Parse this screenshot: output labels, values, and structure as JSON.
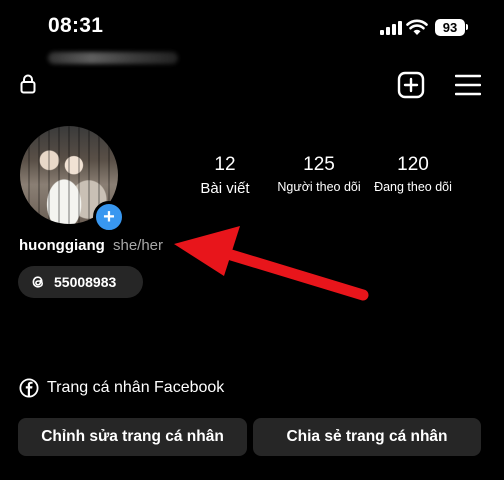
{
  "status_bar": {
    "time": "08:31",
    "battery": "93"
  },
  "profile": {
    "username": "huonggiang",
    "pronouns": "she/her",
    "threads_handle": "55008983"
  },
  "stats": {
    "posts": {
      "value": "12",
      "label": "Bài viết"
    },
    "followers": {
      "value": "125",
      "label": "Người theo dõi"
    },
    "following": {
      "value": "120",
      "label": "Đang theo dõi"
    }
  },
  "links": {
    "facebook": "Trang cá nhân Facebook"
  },
  "buttons": {
    "edit_profile": "Chỉnh sửa trang cá nhân",
    "share_profile": "Chia sẻ trang cá nhân"
  },
  "icons": [
    "lock-icon",
    "add-post-icon",
    "menu-icon",
    "threads-icon",
    "facebook-icon",
    "plus-icon"
  ],
  "colors": {
    "background": "#000000",
    "button": "#262626",
    "accent_blue": "#3897f0",
    "annotation_red": "#e8151b"
  }
}
